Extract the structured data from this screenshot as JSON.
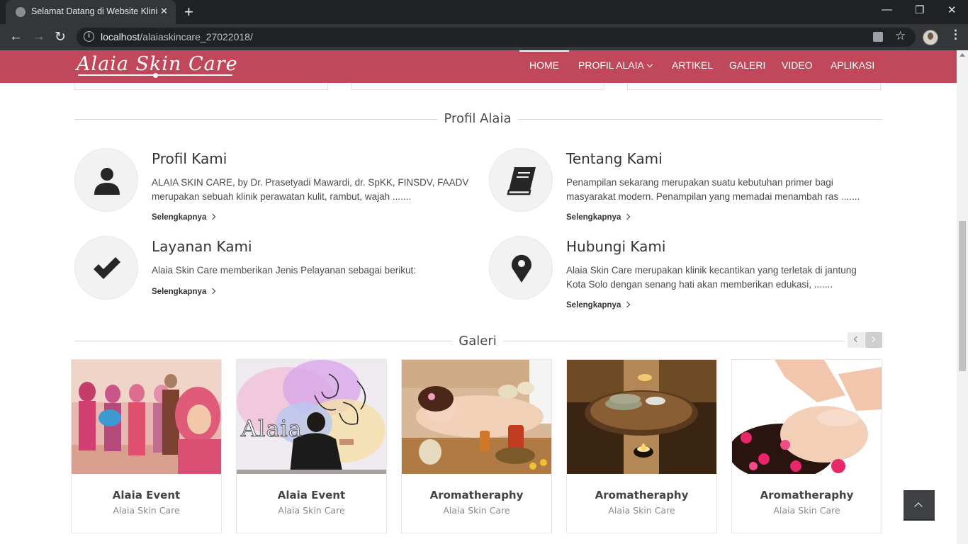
{
  "browser": {
    "tab_title": "Selamat Datang di Website Klinik",
    "url_host": "localhost",
    "url_path": "/alaiaskincare_27022018/"
  },
  "site": {
    "logo": "Alaia Skin Care",
    "menu": [
      "HOME",
      "PROFIL ALAIA",
      "ARTIKEL",
      "GALERI",
      "VIDEO",
      "APLIKASI"
    ],
    "brand_color": "#c0485a"
  },
  "profil": {
    "heading": "Profil Alaia",
    "items": [
      {
        "title": "Profil Kami",
        "icon": "user-icon",
        "text": "ALAIA SKIN CARE, by Dr. Prasetyadi Mawardi, dr. SpKK, FINSDV, FAADV merupakan sebuah klinik perawatan kulit, rambut, wajah .......",
        "more": "Selengkapnya"
      },
      {
        "title": "Tentang Kami",
        "icon": "book-icon",
        "text": "Penampilan sekarang merupakan suatu kebutuhan primer bagi masyarakat modern. Penampilan yang memadai menambah ras .......",
        "more": "Selengkapnya"
      },
      {
        "title": "Layanan Kami",
        "icon": "check-icon",
        "text": "Alaia Skin Care memberikan Jenis Pelayanan sebagai berikut:",
        "more": "Selengkapnya"
      },
      {
        "title": "Hubungi Kami",
        "icon": "map-marker-icon",
        "text": "Alaia Skin Care merupakan klinik kecantikan yang terletak di jantung Kota Solo dengan senang hati akan memberikan edukasi, .......",
        "more": "Selengkapnya"
      }
    ]
  },
  "galeri": {
    "heading": "Galeri",
    "items": [
      {
        "title": "Alaia Event",
        "subtitle": "Alaia Skin Care"
      },
      {
        "title": "Alaia Event",
        "subtitle": "Alaia Skin Care"
      },
      {
        "title": "Aromatheraphy",
        "subtitle": "Alaia Skin Care"
      },
      {
        "title": "Aromatheraphy",
        "subtitle": "Alaia Skin Care"
      },
      {
        "title": "Aromatheraphy",
        "subtitle": "Alaia Skin Care"
      }
    ]
  }
}
